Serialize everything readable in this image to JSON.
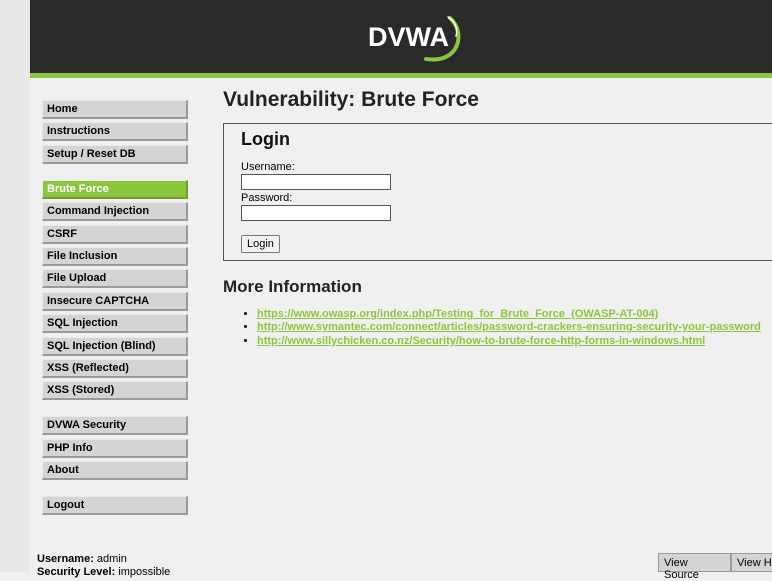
{
  "header": {
    "logo_text": "DVWA",
    "accent_color": "#8cc63f",
    "header_color": "#2a2a2a"
  },
  "menu": {
    "blocks": [
      [
        "Home",
        "Instructions",
        "Setup / Reset DB"
      ],
      [
        "Brute Force",
        "Command Injection",
        "CSRF",
        "File Inclusion",
        "File Upload",
        "Insecure CAPTCHA",
        "SQL Injection",
        "SQL Injection (Blind)",
        "XSS (Reflected)",
        "XSS (Stored)"
      ],
      [
        "DVWA Security",
        "PHP Info",
        "About"
      ],
      [
        "Logout"
      ]
    ],
    "selected": "Brute Force"
  },
  "main": {
    "title": "Vulnerability: Brute Force",
    "login": {
      "heading": "Login",
      "username_label": "Username:",
      "username_value": "",
      "password_label": "Password:",
      "password_value": "",
      "button": "Login"
    },
    "more_info": {
      "heading": "More Information",
      "links": [
        "https://www.owasp.org/index.php/Testing_for_Brute_Force_(OWASP-AT-004)",
        "http://www.symantec.com/connect/articles/password-crackers-ensuring-security-your-password",
        "http://www.sillychicken.co.nz/Security/how-to-brute-force-http-forms-in-windows.html"
      ]
    }
  },
  "footer": {
    "username_label": "Username:",
    "username_value": "admin",
    "security_label": "Security Level:",
    "security_value": "impossible",
    "view_source": "View Source",
    "view_help": "View Help"
  }
}
